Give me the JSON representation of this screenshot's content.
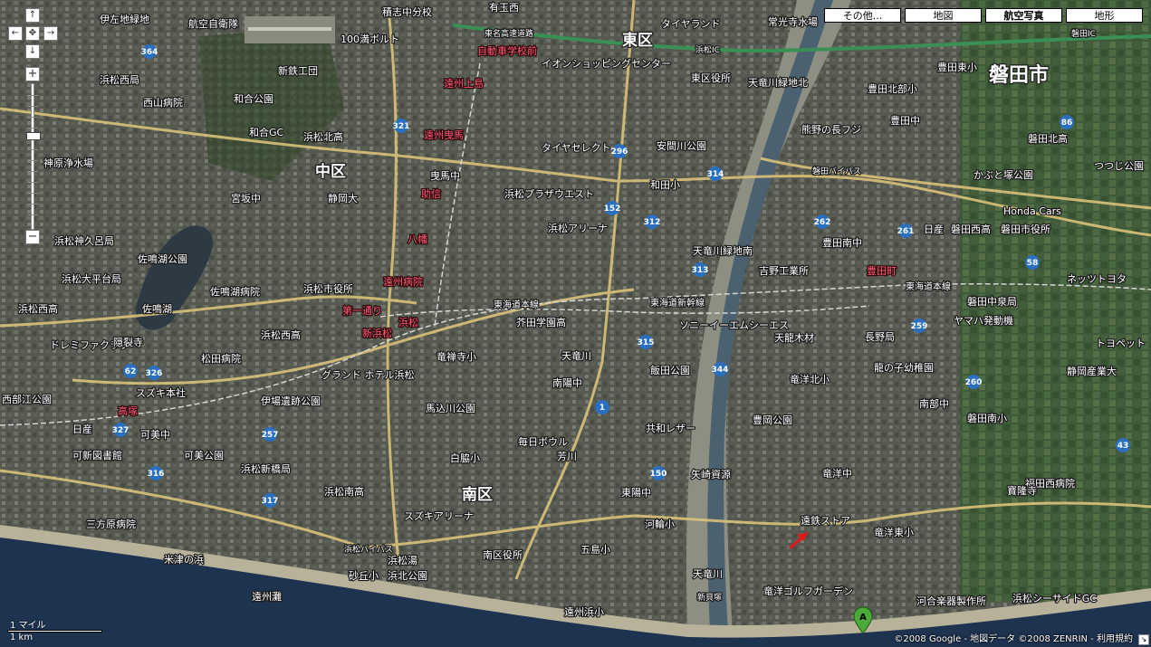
{
  "map_types": [
    "その他...",
    "地図",
    "航空写真",
    "地形"
  ],
  "active_map_type": "航空写真",
  "zoom_level_fraction": 0.35,
  "scale": {
    "imperial": "1 マイル",
    "metric": "1 km"
  },
  "copyright": {
    "text": "©2008 Google - 地図データ ©2008 ZENRIN - ",
    "terms": "利用規約"
  },
  "marker": {
    "letter": "A"
  },
  "labels": {
    "wards": [
      "東区",
      "中区",
      "南区"
    ],
    "cities": [
      "磐田市"
    ],
    "places": {
      "p1": "伊左地緑地",
      "p2": "航空自衛隊",
      "p3": "新鉄工団",
      "p4": "100満ボルト",
      "p5": "積志中分校",
      "p6": "有玉西",
      "p7": "タイヤランド",
      "p8": "常光寺水場",
      "p9": "磐田IC",
      "p10": "浜松西局",
      "p11": "西山病院",
      "p12": "和合公園",
      "p13": "和合GC",
      "p14": "神原浄水場",
      "p15": "浜松北高",
      "p16": "宮坂中",
      "p17": "静岡大",
      "p18": "浜松神久呂局",
      "p19": "佐鳴湖公園",
      "p20": "佐鳴湖",
      "p21": "浜松大平台局",
      "p22": "佐鳴湖病院",
      "p23": "浜松西高",
      "p24": "松田病院",
      "p25": "グランド ホテル浜松",
      "p26": "伊場遺跡公園",
      "p27": "可美中",
      "p28": "可美公園",
      "p29": "浜松新橋局",
      "p30": "浜松南高",
      "p31": "スズキアリーナ",
      "p32": "三方原病院",
      "p33": "米津の浜",
      "p34": "遠州灘",
      "p35": "南区役所",
      "p36": "五島小",
      "p37": "遠州浜小",
      "p38": "浜松アリーナ",
      "p39": "天竜川緑地南",
      "p40": "吉野工業所",
      "p41": "豊田町",
      "p42": "東海道本線",
      "p43": "東海道新幹線",
      "p44": "ソニーイーエムシーエス",
      "p45": "天龍木材",
      "p46": "竜洋北小",
      "p47": "豊岡公園",
      "p48": "遠鉄ストア",
      "p49": "竜洋東小",
      "p50": "竜洋ゴルフガーデン",
      "p51": "浜松シーサイドGC",
      "p52": "福田西病院",
      "p53": "磐田南小",
      "p54": "静岡産業大",
      "p55": "トヨペット",
      "p56": "ネッツトヨタ",
      "p57": "磐田中泉局",
      "p58": "ヤマハ発動機",
      "p59": "磐田西高",
      "p60": "磐田市役所",
      "p61": "Honda Cars",
      "p62": "かぶと塚公園",
      "p63": "磐田北高",
      "p64": "つつじ公園",
      "p65": "豊田東小",
      "p66": "豊田北部小",
      "p67": "豊田中",
      "p68": "熊野の長フジ",
      "p69": "天竜川緑地北",
      "p70": "東区役所",
      "p71": "安間川公園",
      "p72": "和田小",
      "p73": "浜松プラザウエスト",
      "p74": "タイヤセレクト",
      "p75": "イオンショッピングセンター",
      "p76": "自動車学校前",
      "p77": "遠州上島",
      "p78": "遠州曳馬",
      "p79": "曳馬中",
      "p80": "助信",
      "p81": "八幡",
      "p82": "遠州病院",
      "p83": "第一通り",
      "p84": "新浜松",
      "p85": "浜松",
      "p86": "浜松市役所",
      "p87": "東海道本線",
      "p88": "芥田学園高",
      "p89": "竜禅寺小",
      "p90": "馬込川公園",
      "p91": "白脇小",
      "p92": "毎日ボウル",
      "p93": "芳川",
      "p94": "共和レザー",
      "p95": "矢崎資源",
      "p96": "東陽中",
      "p97": "河輪小",
      "p98": "天竜川",
      "p99": "浜松バイパス",
      "p100": "浜松西高",
      "p101": "高塚",
      "p102": "日産",
      "p103": "可新図書館",
      "p104": "スズキ本社",
      "p105": "ドレミファクラブ",
      "p106": "隠裂寺",
      "p107": "西部江公園",
      "p108": "南陽中",
      "p109": "飯田公園",
      "p110": "竜洋中",
      "p111": "長野局",
      "p112": "龍の子幼稚園",
      "p113": "南部中",
      "p114": "豊田南中",
      "p115": "日産",
      "p116": "寶隆寺",
      "p117": "磐田バイパス",
      "p118": "東名高速道路",
      "p119": "浜松IC",
      "p120": "天竜川",
      "p121": "河合楽器製作所",
      "p122": "新貝塚",
      "p123": "砂丘小",
      "p124": "浜松湯",
      "p125": "浜北公園"
    },
    "routes": [
      "364",
      "321",
      "296",
      "152",
      "312",
      "314",
      "313",
      "262",
      "261",
      "86",
      "58",
      "259",
      "260",
      "43",
      "1",
      "315",
      "344",
      "150",
      "257",
      "327",
      "316",
      "317",
      "62",
      "326"
    ]
  }
}
